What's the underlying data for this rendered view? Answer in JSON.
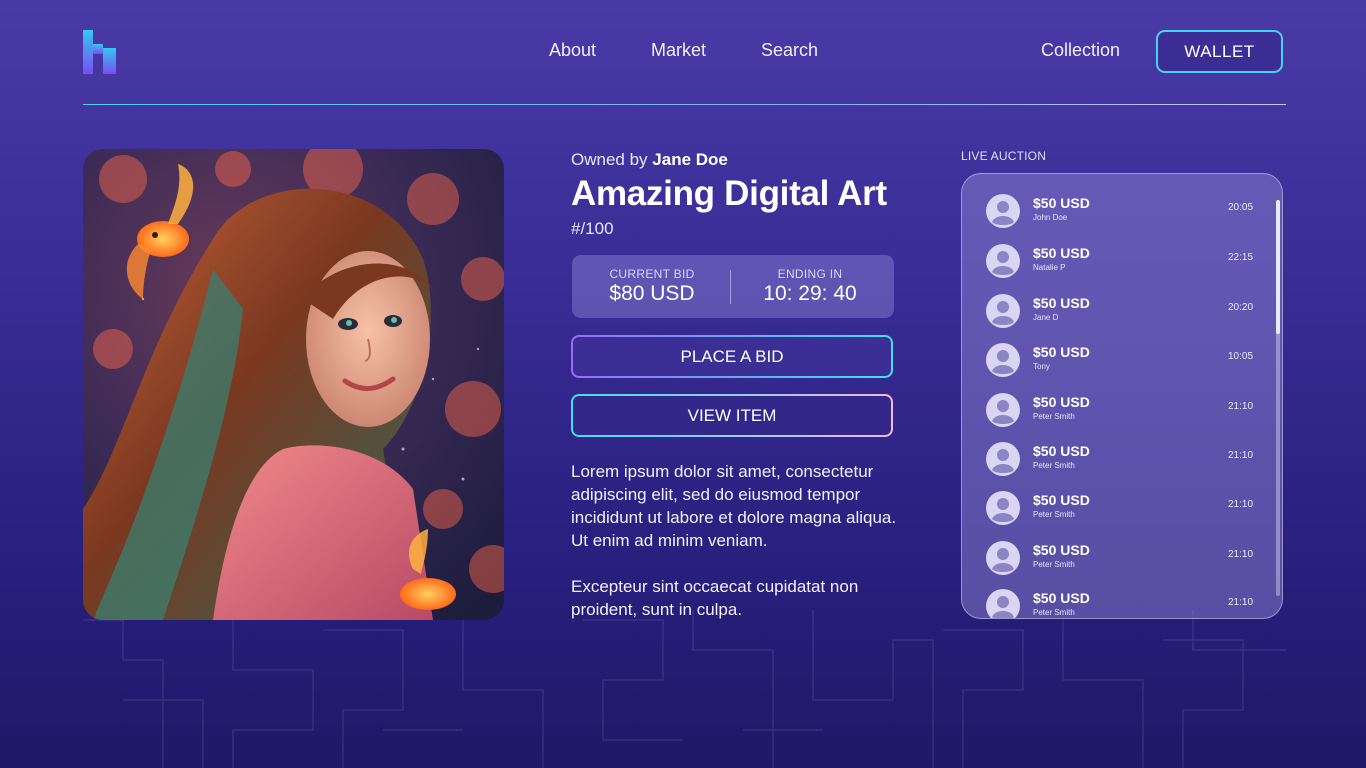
{
  "header": {
    "nav": [
      "About",
      "Market",
      "Search"
    ],
    "collection_label": "Collection",
    "wallet_label": "WALLET",
    "logo_icon": "h-logo-icon"
  },
  "item": {
    "owned_prefix": "Owned by",
    "owner": "Jane Doe",
    "title": "Amazing Digital Art",
    "edition": "#/100",
    "current_bid_label": "CURRENT BID",
    "current_bid_value": "$80 USD",
    "ending_label": "ENDING IN",
    "ending_value": "10: 29: 40",
    "place_bid_label": "PLACE A BID",
    "view_item_label": "VIEW ITEM",
    "description_1": "Lorem ipsum dolor sit amet, consectetur adipiscing elit, sed do eiusmod tempor incididunt ut labore et dolore magna aliqua. Ut enim ad minim veniam.",
    "description_2": "Excepteur sint occaecat cupidatat non proident, sunt in culpa."
  },
  "auction": {
    "label": "LIVE AUCTION",
    "bids": [
      {
        "amount": "$50 USD",
        "name": "John Doe",
        "time": "20:05"
      },
      {
        "amount": "$50 USD",
        "name": "Natalie P",
        "time": "22:15"
      },
      {
        "amount": "$50 USD",
        "name": "Jane D",
        "time": "20:20"
      },
      {
        "amount": "$50 USD",
        "name": "Tony",
        "time": "10:05"
      },
      {
        "amount": "$50 USD",
        "name": "Peter Smith",
        "time": "21:10"
      },
      {
        "amount": "$50 USD",
        "name": "Peter Smith",
        "time": "21:10"
      },
      {
        "amount": "$50 USD",
        "name": "Peter Smith",
        "time": "21:10"
      },
      {
        "amount": "$50 USD",
        "name": "Peter Smith",
        "time": "21:10"
      },
      {
        "amount": "$50 USD",
        "name": "Peter Smith",
        "time": "21:10"
      }
    ]
  },
  "colors": {
    "accent_cyan": "#3fd6f0",
    "accent_purple": "#9a6cf5",
    "background_top": "#4a3aa6",
    "background_bottom": "#1f1868"
  }
}
